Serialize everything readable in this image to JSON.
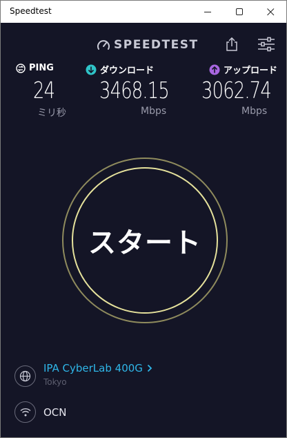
{
  "window": {
    "title": "Speedtest"
  },
  "header": {
    "logo_text": "SPEEDTEST",
    "logo_icon": "speedometer-icon",
    "share_icon": "share-icon",
    "settings_icon": "settings-sliders-icon"
  },
  "stats": {
    "ping": {
      "label": "PING",
      "value": "24",
      "unit": "ミリ秒",
      "icon": "ping-icon",
      "color": "#ffffff"
    },
    "download": {
      "label": "ダウンロード",
      "value": "3468.15",
      "unit": "Mbps",
      "icon": "download-arrow-icon",
      "color": "#2fc4c8"
    },
    "upload": {
      "label": "アップロード",
      "value": "3062.74",
      "unit": "Mbps",
      "icon": "upload-arrow-icon",
      "color": "#a866e0"
    }
  },
  "start": {
    "label": "スタート"
  },
  "server": {
    "name": "IPA CyberLab 400G",
    "location": "Tokyo",
    "icon": "globe-icon"
  },
  "isp": {
    "name": "OCN",
    "icon": "wifi-icon"
  },
  "colors": {
    "background": "#141526",
    "accent_link": "#2fb6e8",
    "ring": "#e6e29c"
  }
}
